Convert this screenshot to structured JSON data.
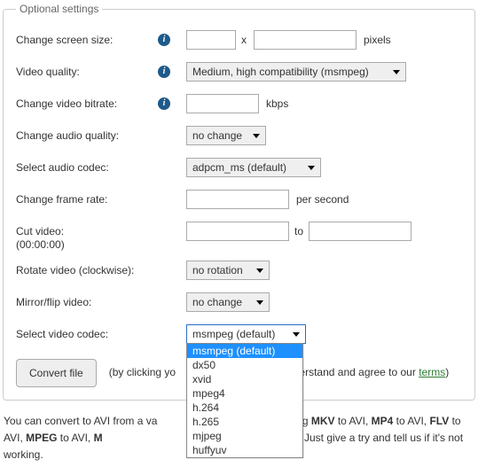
{
  "fieldset_legend": "Optional settings",
  "screen": {
    "label": "Change screen size:",
    "w": "",
    "h": "",
    "sep": "x",
    "unit": "pixels"
  },
  "quality": {
    "label": "Video quality:",
    "value": "Medium, high compatibility (msmpeg)"
  },
  "vbitrate": {
    "label": "Change video bitrate:",
    "value": "",
    "unit": "kbps"
  },
  "aquality": {
    "label": "Change audio quality:",
    "value": "no change"
  },
  "acodec": {
    "label": "Select audio codec:",
    "value": "adpcm_ms (default)"
  },
  "framerate": {
    "label": "Change frame rate:",
    "value": "",
    "unit": "per second"
  },
  "cut": {
    "label": "Cut video:",
    "start": "",
    "end": "",
    "sep": "to",
    "hint": "(00:00:00)"
  },
  "rotate": {
    "label": "Rotate video (clockwise):",
    "value": "no rotation"
  },
  "mirror": {
    "label": "Mirror/flip video:",
    "value": "no change"
  },
  "vcodec": {
    "label": "Select video codec:",
    "value": "msmpeg (default)",
    "options": [
      "msmpeg (default)",
      "dx50",
      "xvid",
      "mpeg4",
      "h.264",
      "h.265",
      "mjpeg",
      "huffyuv"
    ],
    "selected_index": 0
  },
  "convert": {
    "button": "Convert file",
    "consent_a": "(by clicking yo",
    "consent_b": "derstand and agree to our ",
    "terms": "terms",
    "consent_c": ")"
  },
  "footer": {
    "a": "You can convert to AVI from a va",
    "b": "including ",
    "mkv": "MKV",
    "c": " to AVI, ",
    "mp4": "MP4",
    "d": " to AVI, ",
    "flv": "FLV",
    "e": " to AVI, ",
    "mpeg": "MPEG",
    "f": " to AVI, ",
    "m": "M",
    "g": "VI and many more. Just give a try and tell us if it's not working."
  }
}
